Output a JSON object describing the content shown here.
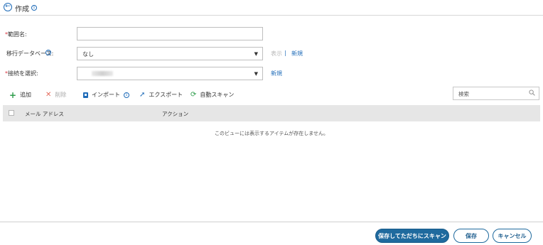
{
  "header": {
    "title": "作成"
  },
  "form": {
    "range_name": {
      "label": "範囲名:",
      "value": ""
    },
    "migration_db": {
      "label": "移行データベース:",
      "value": "なし",
      "show_link": "表示",
      "divider": "|",
      "new_link": "新規"
    },
    "connection": {
      "label": "接続を選択:",
      "value": "",
      "new_link": "新規"
    }
  },
  "toolbar": {
    "add": "追加",
    "delete": "削除",
    "import": "インポート",
    "export": "エクスポート",
    "auto_scan": "自動スキャン",
    "search_placeholder": "検索"
  },
  "table": {
    "columns": [
      "メール アドレス",
      "アクション"
    ],
    "empty_message": "このビューには表示するアイテムが存在しません。"
  },
  "footer": {
    "save_and_scan": "保存してただちにスキャン",
    "save": "保存",
    "cancel": "キャンセル"
  },
  "colors": {
    "accent": "#1e6bb8",
    "primary_button": "#1f6a9e",
    "required": "#d9363e",
    "add_icon": "#2e9c4b",
    "delete_icon": "#e46b5c"
  }
}
